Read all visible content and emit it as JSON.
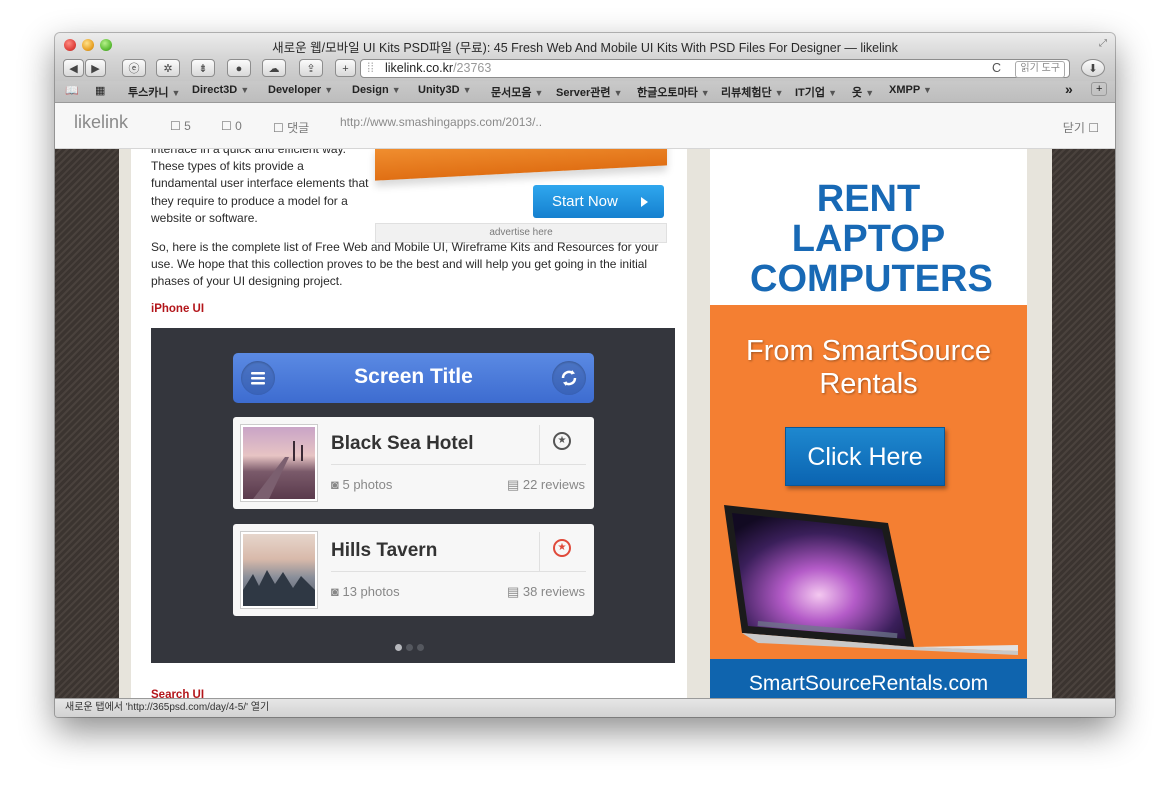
{
  "window": {
    "title": "새로운 웹/모바일 UI Kits PSD파일 (무료): 45 Fresh Web And Mobile UI Kits With PSD Files For Designer — likelink"
  },
  "toolbar": {
    "back_icon": "◀",
    "forward_icon": "▶",
    "url_host": "likelink.co.kr",
    "url_path": "/23763",
    "reload_icon": "C",
    "reader_label": "읽기 도구",
    "add_icon": "+"
  },
  "bookmarks": [
    {
      "label": "투스카니",
      "arrow": "▼"
    },
    {
      "label": "Direct3D",
      "arrow": "▼"
    },
    {
      "label": "Developer",
      "arrow": "▼"
    },
    {
      "label": "Design",
      "arrow": "▼"
    },
    {
      "label": "Unity3D",
      "arrow": "▼"
    },
    {
      "label": "문서모음",
      "arrow": "▼"
    },
    {
      "label": "Server관련",
      "arrow": "▼"
    },
    {
      "label": "한글오토마타",
      "arrow": "▼"
    },
    {
      "label": "리뷰체험단",
      "arrow": "▼"
    },
    {
      "label": "IT기업",
      "arrow": "▼"
    },
    {
      "label": "옷",
      "arrow": "▼"
    },
    {
      "label": "XMPP",
      "arrow": "▼"
    }
  ],
  "bookmarks_more": "»",
  "page_header": {
    "logo": "likelink",
    "likes": "5",
    "shares": "0",
    "comments_label": "댓글",
    "source_url": "http://www.smashingapps.com/2013/..",
    "close_label": "닫기"
  },
  "article": {
    "para1": "interface in a quick and efficient way. These types of kits provide a fundamental user interface elements that they require to produce a model for a website or software.",
    "para2": "So, here is the complete list of Free Web and Mobile UI, Wireframe Kits and Resources for your use. We hope that this collection proves to be the best and will help you get going in the initial phases of your UI designing project.",
    "section1": "iPhone UI",
    "section2": "Search UI",
    "start_now": "Start Now",
    "advertise": "advertise here"
  },
  "showcase": {
    "screen_title": "Screen Title",
    "items": [
      {
        "name": "Black Sea Hotel",
        "photos": "5 photos",
        "reviews": "22 reviews",
        "starred": false
      },
      {
        "name": "Hills Tavern",
        "photos": "13 photos",
        "reviews": "38 reviews",
        "starred": true
      }
    ],
    "page_dots": 3,
    "active_dot": 1
  },
  "ad": {
    "headline": "RENT LAPTOP COMPUTERS",
    "tagline": "From SmartSource Rentals",
    "cta": "Click Here",
    "site": "SmartSourceRentals.com"
  },
  "status_bar": {
    "text": "새로운 탭에서 'http://365psd.com/day/4-5/' 열기"
  },
  "colors": {
    "accent_blue": "#1580cf",
    "ad_orange": "#f47f32",
    "ad_blue": "#1869b5",
    "section_red": "#b3151a",
    "app_bar_blue": "#3d6cd0"
  }
}
